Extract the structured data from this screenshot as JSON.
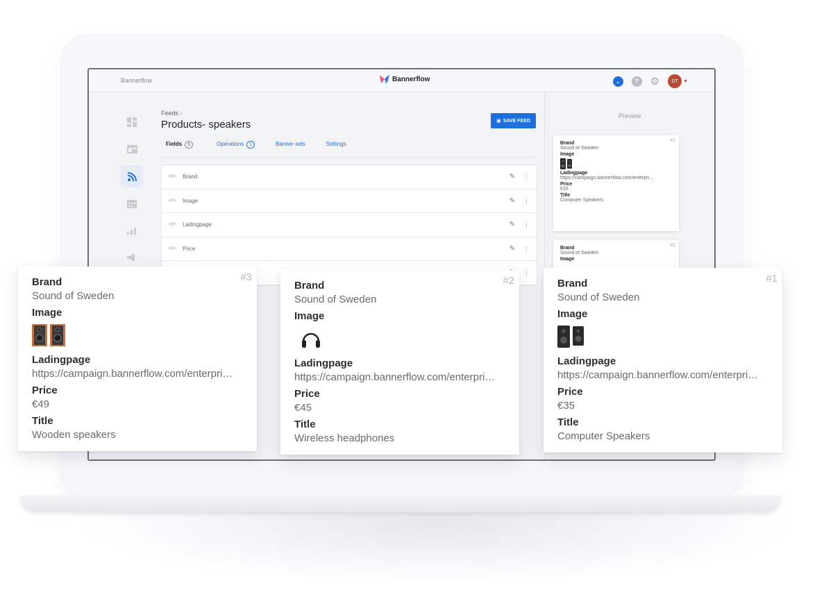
{
  "app": {
    "left_title": "Bannerflow",
    "logo_text": "Bannerflow",
    "avatar_initials": "DT",
    "help_label": "?",
    "accent_color": "#1e6fd9",
    "avatar_color": "#b94a30"
  },
  "sidebar": {
    "icons": [
      "dashboard-icon",
      "layout-icon",
      "rss-feed-icon",
      "calendar-icon",
      "analytics-icon",
      "megaphone-icon"
    ],
    "active": "rss-feed-icon"
  },
  "main": {
    "breadcrumb": "Feeds",
    "breadcrumb_separator": "›",
    "title": "Products- speakers",
    "save_label": "SAVE FEED",
    "tabs": [
      {
        "label": "Fields",
        "count": "5"
      },
      {
        "label": "Operations",
        "count": "1"
      },
      {
        "label": "Banner sets"
      },
      {
        "label": "Settings"
      }
    ],
    "code_icon_label": "</>",
    "fields": [
      "Brand",
      "Image",
      "Ladingpage",
      "Price"
    ]
  },
  "preview": {
    "label": "Preview",
    "cards": [
      {
        "num": "#1",
        "brand_label": "Brand",
        "brand": "Sound of Sweden",
        "image_label": "Image",
        "landing_label": "Ladingpage",
        "landing": "https://campaign.bannerflow.com/enterpri…",
        "price_label": "Price",
        "price": "€35",
        "title_label": "Title",
        "title": "Computer Speakers"
      },
      {
        "num": "#2",
        "brand_label": "Brand",
        "brand": "Sound of Sweden",
        "image_label": "Image"
      }
    ]
  },
  "cards": [
    {
      "num": "#3",
      "brand_label": "Brand",
      "brand": "Sound of Sweden",
      "image_label": "Image",
      "image_icon": "wooden-speakers-icon",
      "landing_label": "Ladingpage",
      "landing": "https://campaign.bannerflow.com/enterpri…",
      "price_label": "Price",
      "price": "€49",
      "title_label": "Title",
      "title": "Wooden speakers"
    },
    {
      "num": "#2",
      "brand_label": "Brand",
      "brand": "Sound of Sweden",
      "image_label": "Image",
      "image_icon": "headphones-icon",
      "landing_label": "Ladingpage",
      "landing": "https://campaign.bannerflow.com/enterpri…",
      "price_label": "Price",
      "price": "€45",
      "title_label": "Title",
      "title": "Wireless headphones"
    },
    {
      "num": "#1",
      "brand_label": "Brand",
      "brand": "Sound of Sweden",
      "image_label": "Image",
      "image_icon": "computer-speakers-icon",
      "landing_label": "Ladingpage",
      "landing": "https://campaign.bannerflow.com/enterpri…",
      "price_label": "Price",
      "price": "€35",
      "title_label": "Title",
      "title": "Computer Speakers"
    }
  ]
}
